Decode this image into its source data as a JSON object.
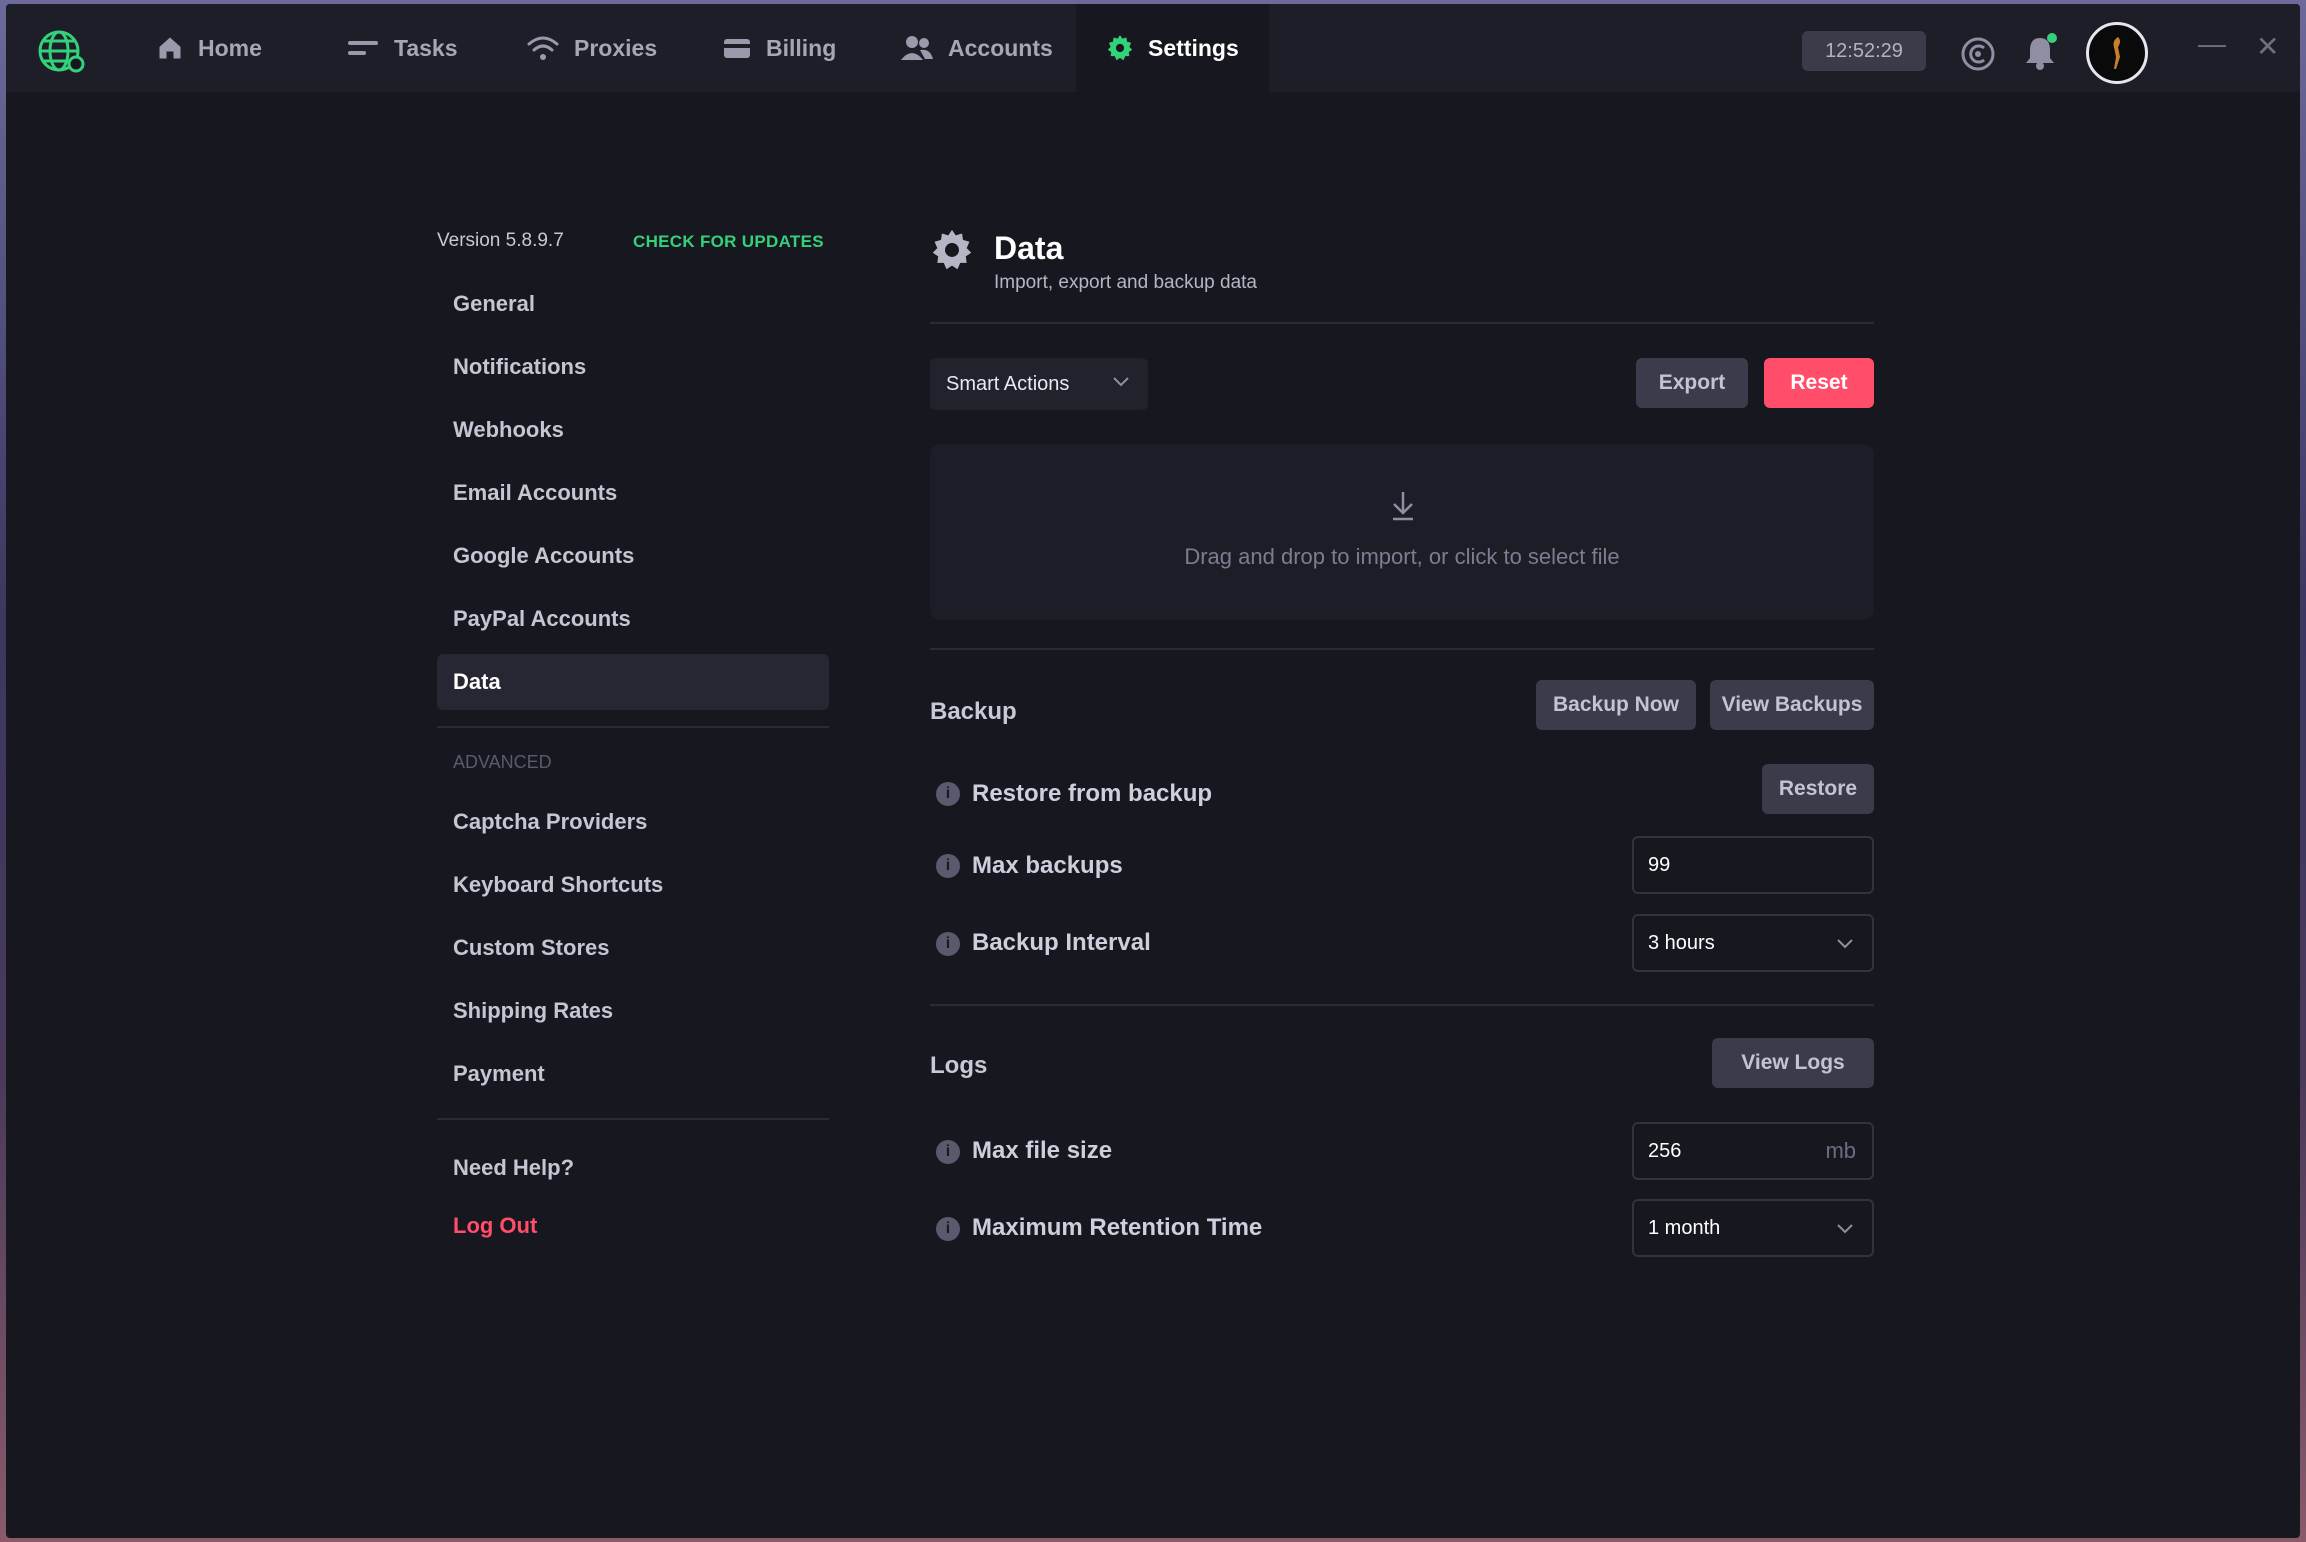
{
  "topbar": {
    "nav": [
      {
        "label": "Home",
        "icon": "home-icon"
      },
      {
        "label": "Tasks",
        "icon": "tasks-icon"
      },
      {
        "label": "Proxies",
        "icon": "wifi-icon"
      },
      {
        "label": "Billing",
        "icon": "card-icon"
      },
      {
        "label": "Accounts",
        "icon": "users-icon"
      },
      {
        "label": "Settings",
        "icon": "gear-icon"
      }
    ],
    "active": "Settings",
    "clock": "12:52:29",
    "accent": "#33d17a"
  },
  "sidebar": {
    "version": "Version 5.8.9.7",
    "check_updates": "CHECK FOR UPDATES",
    "items": [
      "General",
      "Notifications",
      "Webhooks",
      "Email Accounts",
      "Google Accounts",
      "PayPal Accounts",
      "Data"
    ],
    "active": "Data",
    "advanced_label": "ADVANCED",
    "advanced_items": [
      "Captcha Providers",
      "Keyboard Shortcuts",
      "Custom Stores",
      "Shipping Rates",
      "Payment"
    ],
    "help": "Need Help?",
    "logout": "Log Out"
  },
  "main": {
    "title": "Data",
    "subtitle": "Import, export and backup data",
    "smart_actions": "Smart Actions",
    "export_label": "Export",
    "reset_label": "Reset",
    "dropzone_text": "Drag and drop to import, or click to select file",
    "backup": {
      "title": "Backup",
      "backup_now": "Backup Now",
      "view_backups": "View Backups",
      "restore_label": "Restore from backup",
      "restore_button": "Restore",
      "max_backups_label": "Max backups",
      "max_backups_value": "99",
      "interval_label": "Backup Interval",
      "interval_value": "3 hours"
    },
    "logs": {
      "title": "Logs",
      "view_logs": "View Logs",
      "max_size_label": "Max file size",
      "max_size_value": "256",
      "max_size_unit": "mb",
      "retention_label": "Maximum Retention Time",
      "retention_value": "1 month"
    }
  }
}
